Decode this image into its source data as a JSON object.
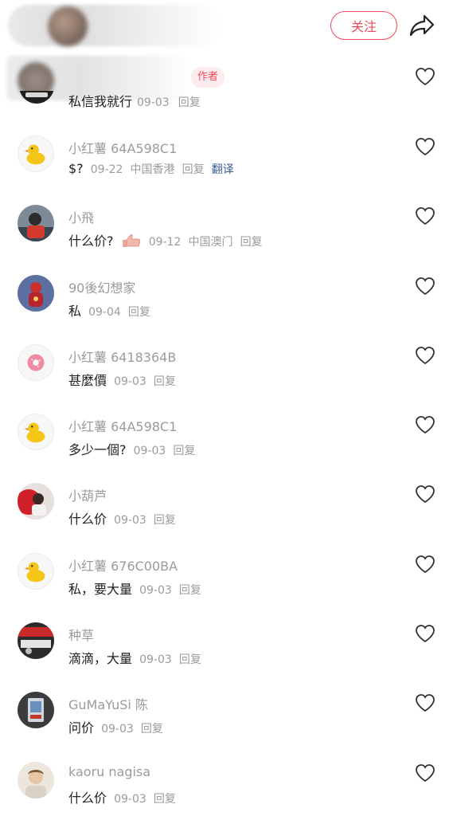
{
  "header": {
    "follow_label": "关注"
  },
  "top_comment": {
    "badge": "作者",
    "text": "私信我就行",
    "date": "09-03",
    "reply": "回复"
  },
  "comments": [
    {
      "user": "小红薯 64A598C1",
      "text": "$?",
      "date": "09-22",
      "location": "中国香港",
      "reply": "回复",
      "translate": "翻译",
      "avatar": "duck-icon"
    },
    {
      "user": "小飛",
      "text": "什么价?",
      "date": "09-12",
      "location": "中国澳门",
      "reply": "回复",
      "avatar": "photo-person",
      "emoji": "thumbs-up-icon"
    },
    {
      "user": "90後幻想家",
      "text": "私",
      "date": "09-04",
      "reply": "回复",
      "avatar": "photo-figure"
    },
    {
      "user": "小红薯 6418364B",
      "text": "甚麼價",
      "date": "09-03",
      "reply": "回复",
      "avatar": "donut-icon"
    },
    {
      "user": "小红薯 64A598C1",
      "text": "多少一個?",
      "date": "09-03",
      "reply": "回复",
      "avatar": "duck-icon"
    },
    {
      "user": "小葫芦",
      "text": "什么价",
      "date": "09-03",
      "reply": "回复",
      "avatar": "photo-red"
    },
    {
      "user": "小红薯 676C00BA",
      "text": "私，要大量",
      "date": "09-03",
      "reply": "回复",
      "avatar": "duck-icon"
    },
    {
      "user": "种草",
      "text": "滴滴，大量",
      "date": "09-03",
      "reply": "回复",
      "avatar": "photo-shelf"
    },
    {
      "user": "GuMaYuSi 陈",
      "text": "问价",
      "date": "09-03",
      "reply": "回复",
      "avatar": "photo-card"
    },
    {
      "user": "kaoru nagisa",
      "text": "什么价",
      "date": "09-03",
      "reply": "回复",
      "avatar": "photo-man"
    }
  ],
  "colors": {
    "accent": "#ef4a5a",
    "meta": "#9b9b9b",
    "translate": "#3b5e93"
  }
}
